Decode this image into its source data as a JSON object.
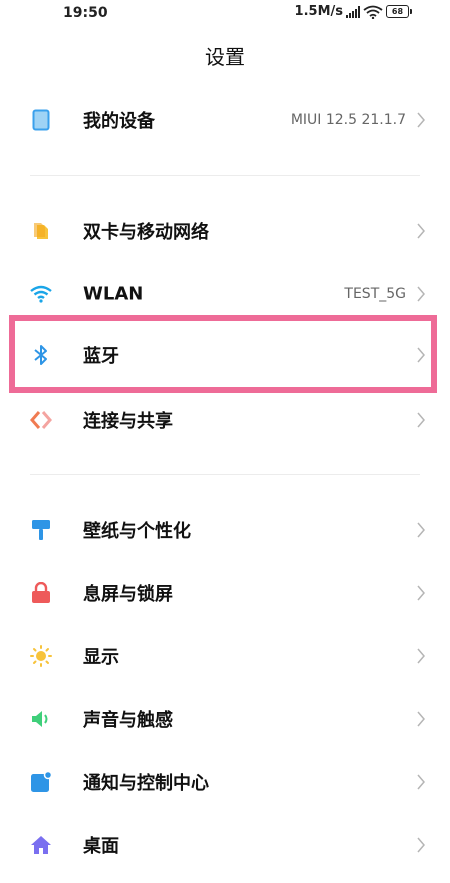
{
  "status_bar": {
    "time": "19:50",
    "net_speed": "1.5M/s",
    "battery": "68"
  },
  "title": "设置",
  "items": [
    {
      "label": "我的设备",
      "value": "MIUI 12.5 21.1.7"
    },
    {
      "label": "双卡与移动网络",
      "value": ""
    },
    {
      "label": "WLAN",
      "value": "TEST_5G"
    },
    {
      "label": "蓝牙",
      "value": ""
    },
    {
      "label": "连接与共享",
      "value": ""
    },
    {
      "label": "壁纸与个性化",
      "value": ""
    },
    {
      "label": "息屏与锁屏",
      "value": ""
    },
    {
      "label": "显示",
      "value": ""
    },
    {
      "label": "声音与触感",
      "value": ""
    },
    {
      "label": "通知与控制中心",
      "value": ""
    },
    {
      "label": "桌面",
      "value": ""
    }
  ],
  "colors": {
    "highlight": "#ee6b97",
    "accent_blue": "#3aa0ec"
  }
}
